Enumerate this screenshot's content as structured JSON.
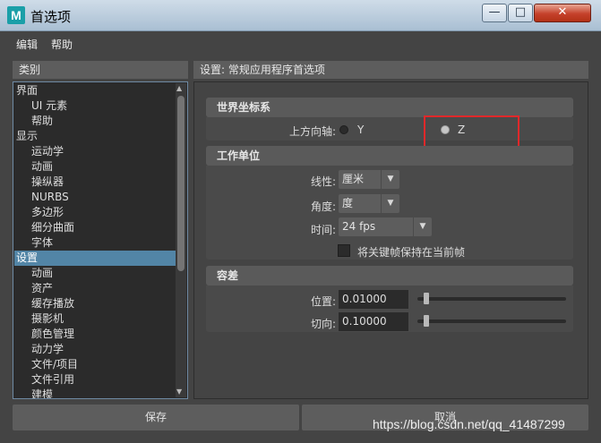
{
  "window": {
    "app_icon_letter": "M",
    "title": "首选项",
    "minimize_glyph": "—",
    "maximize_glyph": "□",
    "close_glyph": "✕"
  },
  "menu": {
    "edit": "编辑",
    "help": "帮助"
  },
  "categories": {
    "header": "类别",
    "items": [
      {
        "label": "界面",
        "level": 0,
        "selected": false
      },
      {
        "label": "UI 元素",
        "level": 1,
        "selected": false
      },
      {
        "label": "帮助",
        "level": 1,
        "selected": false
      },
      {
        "label": "显示",
        "level": 0,
        "selected": false
      },
      {
        "label": "运动学",
        "level": 1,
        "selected": false
      },
      {
        "label": "动画",
        "level": 1,
        "selected": false
      },
      {
        "label": "操纵器",
        "level": 1,
        "selected": false
      },
      {
        "label": "NURBS",
        "level": 1,
        "selected": false
      },
      {
        "label": "多边形",
        "level": 1,
        "selected": false
      },
      {
        "label": "细分曲面",
        "level": 1,
        "selected": false
      },
      {
        "label": "字体",
        "level": 1,
        "selected": false
      },
      {
        "label": "设置",
        "level": 0,
        "selected": true
      },
      {
        "label": "动画",
        "level": 1,
        "selected": false
      },
      {
        "label": "资产",
        "level": 1,
        "selected": false
      },
      {
        "label": "缓存播放",
        "level": 1,
        "selected": false
      },
      {
        "label": "摄影机",
        "level": 1,
        "selected": false
      },
      {
        "label": "颜色管理",
        "level": 1,
        "selected": false
      },
      {
        "label": "动力学",
        "level": 1,
        "selected": false
      },
      {
        "label": "文件/项目",
        "level": 1,
        "selected": false
      },
      {
        "label": "文件引用",
        "level": 1,
        "selected": false
      },
      {
        "label": "建模",
        "level": 1,
        "selected": false
      }
    ]
  },
  "settings": {
    "header": "设置: 常规应用程序首选项",
    "world_coords": {
      "title": "世界坐标系",
      "up_axis_label": "上方向轴:",
      "options": [
        {
          "label": "Y",
          "checked": false
        },
        {
          "label": "Z",
          "checked": true
        }
      ]
    },
    "working_units": {
      "title": "工作单位",
      "linear_label": "线性:",
      "linear_value": "厘米",
      "angular_label": "角度:",
      "angular_value": "度",
      "time_label": "时间:",
      "time_value": "24 fps",
      "keep_keys_label": "将关键帧保持在当前帧",
      "keep_keys_checked": false
    },
    "tolerance": {
      "title": "容差",
      "position_label": "位置:",
      "position_value": "0.01000",
      "position_slider_fraction": 0.04,
      "tangent_label": "切向:",
      "tangent_value": "0.10000",
      "tangent_slider_fraction": 0.04
    }
  },
  "buttons": {
    "save": "保存",
    "cancel": "取消"
  },
  "watermark": "https://blog.csdn.net/qq_41487299",
  "icons": {
    "dropdown": "▼",
    "scroll_up": "▲",
    "scroll_down": "▼"
  },
  "colors": {
    "selection": "#5285a6",
    "highlight_box": "#e0282a",
    "background": "#444444"
  }
}
